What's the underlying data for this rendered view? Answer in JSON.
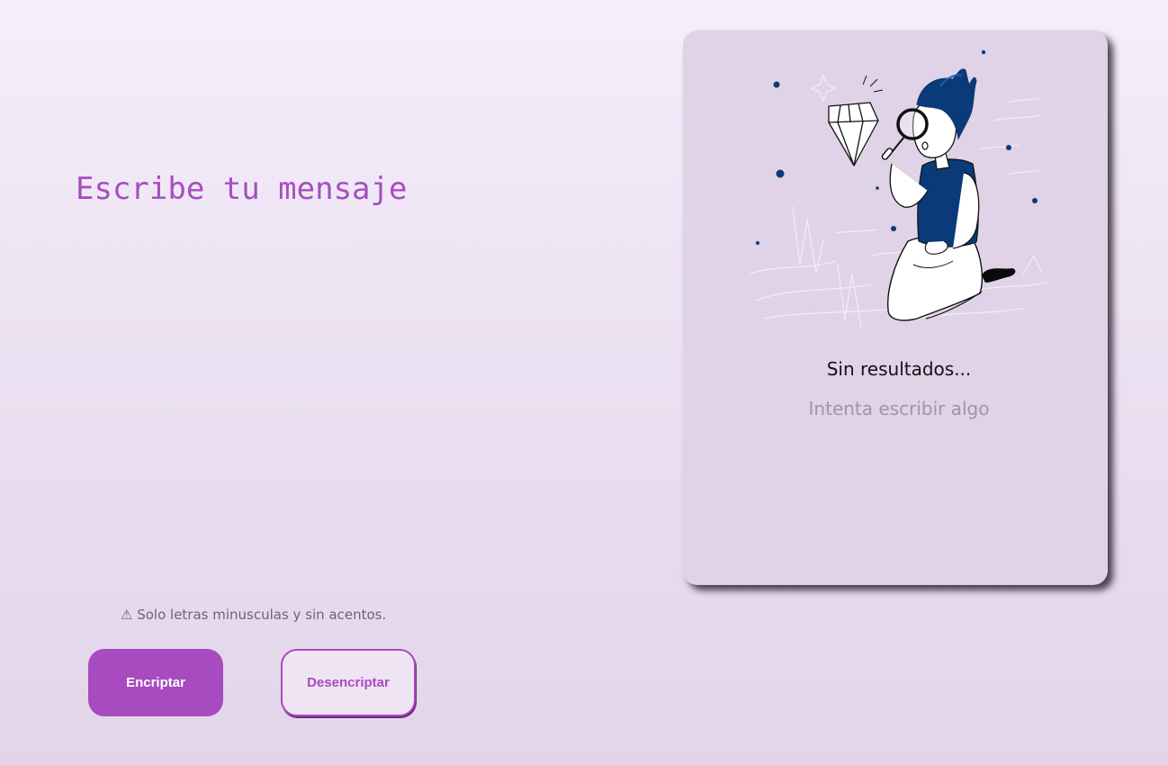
{
  "input": {
    "placeholder": "Escribe tu mensaje",
    "value": ""
  },
  "warning": {
    "icon": "warning-icon",
    "text": "⚠ Solo letras minusculas y sin acentos."
  },
  "buttons": {
    "encrypt_label": "Encriptar",
    "decrypt_label": "Desencriptar"
  },
  "result": {
    "illustration": "person-searching-diamond-illustration",
    "title": "Sin resultados...",
    "subtitle": "Intenta escribir algo"
  },
  "colors": {
    "accent": "#a84ac0",
    "panel": "#e0d2e7",
    "navy": "#0a3a78"
  }
}
